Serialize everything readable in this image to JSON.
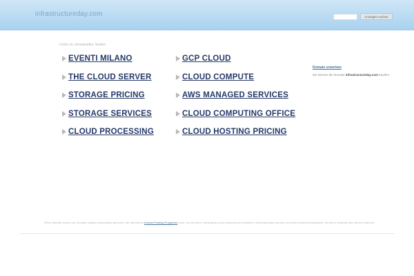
{
  "header": {
    "domain": "infrastructureday.com",
    "search_placeholder": "",
    "search_button": "Anzeigen suchen"
  },
  "links": {
    "caption": "Links zu verwandten Seiten",
    "items": [
      "EVENTI MILANO",
      "GCP CLOUD",
      "THE CLOUD SERVER",
      "CLOUD COMPUTE",
      "STORAGE PRICING",
      "AWS MANAGED SERVICES",
      "STORAGE SERVICES",
      "CLOUD COMPUTING OFFICE",
      "CLOUD PROCESSING",
      "CLOUD HOSTING PRICING"
    ]
  },
  "sidebar": {
    "title": "Domain erwerben",
    "text_prefix": "Sie können die Domain",
    "domain": "infrastructureday.com",
    "text_suffix": "kaufen!"
  },
  "footer": {
    "text_before": "Diese Website wurde vom Domain-Inhaber automatisch generiert, der das Dienst",
    "link": "Domain Parking Programm",
    "text_after": "nutzt. Sie hat keine Verbindung zu den beworbenen Anbietern. Werbeanzeigen werden von einem Dienst bereitgestellt, der keine Kontrolle über deren Inhalt hat."
  }
}
